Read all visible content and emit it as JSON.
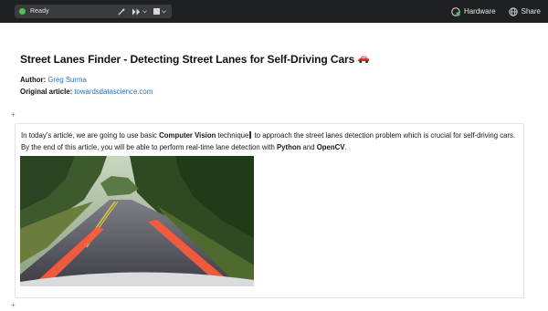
{
  "status": {
    "text": "Ready",
    "color": "#4cc35a"
  },
  "toolbar": {
    "icons": [
      "wand-icon",
      "run-icon",
      "chevron-down-icon",
      "stop-icon",
      "chevron-down-icon"
    ]
  },
  "header_right": {
    "hardware_label": "Hardware",
    "share_label": "Share"
  },
  "doc": {
    "title": "Street Lanes Finder - Detecting Street Lanes for Self-Driving Cars",
    "title_emoji": "car-icon",
    "author_label": "Author:",
    "author_name": "Greg Surma",
    "article_label": "Original article:",
    "article_link": "towardsdatascience.com",
    "para_1": "In today’s article, we are going to use basic ",
    "para_bold_1": "Computer Vision",
    "para_2": " technique",
    "para_3": " to approach the street lanes detection problem which is crucial for self-driving cars. By the end of this article, you will be able to perform real-time lane detection with ",
    "para_bold_2": "Python",
    "para_4": " and ",
    "para_bold_3": "OpenCV",
    "para_5": ".",
    "add_symbol": "+"
  },
  "colors": {
    "topbar": "#1f2023",
    "link": "#2c6fc4",
    "lane_overlay": "#ff5a3c"
  }
}
